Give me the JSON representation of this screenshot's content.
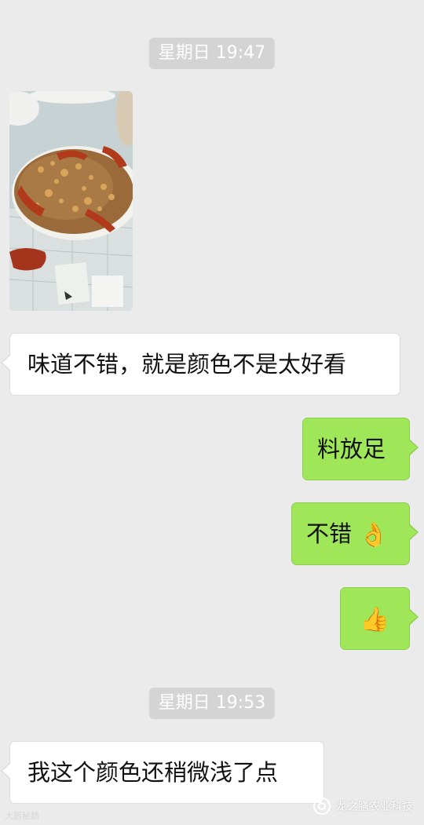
{
  "chat": {
    "messages": [
      {
        "kind": "timestamp",
        "text": "星期日 19:47"
      },
      {
        "kind": "image",
        "from": "other",
        "alt_icon": "food-photo"
      },
      {
        "kind": "text",
        "from": "other",
        "text": "味道不错，就是颜色不是太好看"
      },
      {
        "kind": "text",
        "from": "me",
        "text": "料放足"
      },
      {
        "kind": "text",
        "from": "me",
        "text": "不错",
        "emoji": "👌"
      },
      {
        "kind": "emoji",
        "from": "me",
        "emoji": "👍"
      },
      {
        "kind": "timestamp",
        "text": "星期日 19:53"
      },
      {
        "kind": "text",
        "from": "other",
        "text": "我这个颜色还稍微浅了点"
      }
    ]
  },
  "watermarks": {
    "left": "大厨秘籍",
    "right": "龙之膳农业科技"
  },
  "colors": {
    "background": "#ebebeb",
    "incoming_bubble": "#ffffff",
    "outgoing_bubble": "#9fe658",
    "timestamp_pill": "#d4d4d4"
  }
}
